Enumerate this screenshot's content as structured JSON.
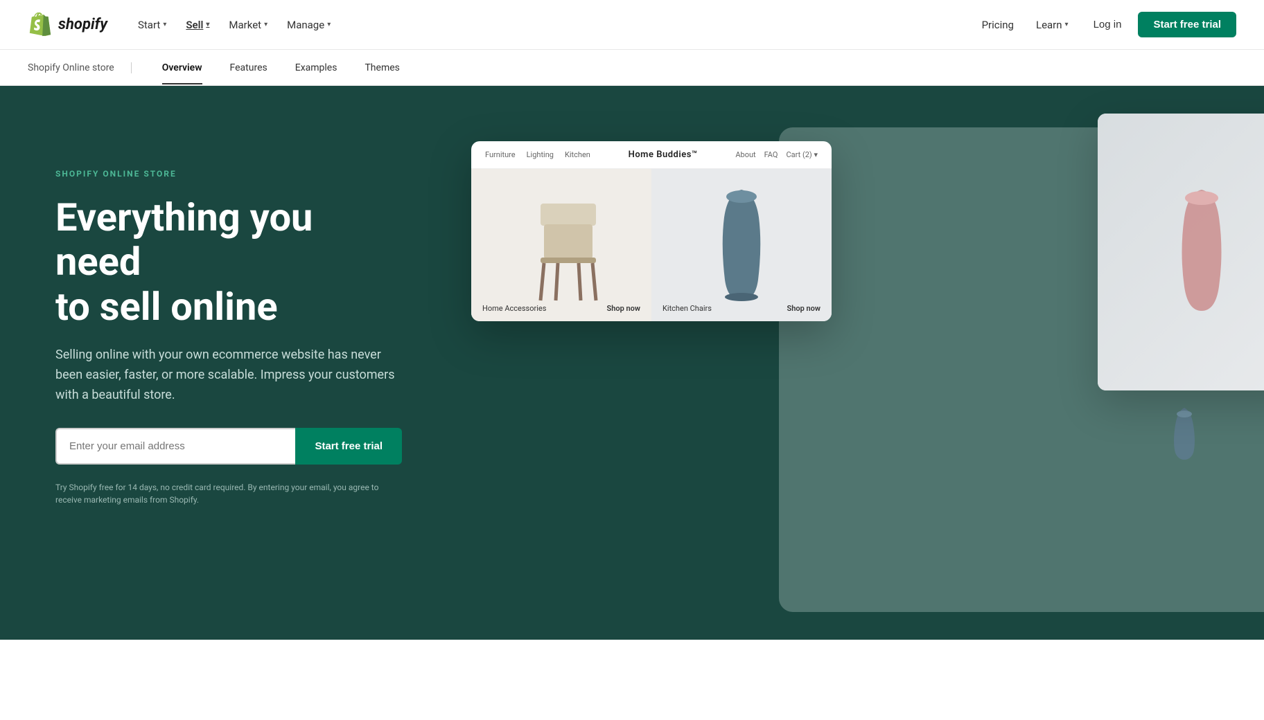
{
  "nav": {
    "logo_text": "shopify",
    "links_left": [
      {
        "label": "Start",
        "has_dropdown": true,
        "active": false
      },
      {
        "label": "Sell",
        "has_dropdown": true,
        "active": true
      },
      {
        "label": "Market",
        "has_dropdown": true,
        "active": false
      },
      {
        "label": "Manage",
        "has_dropdown": true,
        "active": false
      }
    ],
    "pricing_label": "Pricing",
    "learn_label": "Learn",
    "login_label": "Log in",
    "trial_label": "Start free trial"
  },
  "subnav": {
    "brand_label": "Shopify Online store",
    "items": [
      {
        "label": "Overview",
        "active": true
      },
      {
        "label": "Features",
        "active": false
      },
      {
        "label": "Examples",
        "active": false
      },
      {
        "label": "Themes",
        "active": false
      }
    ]
  },
  "hero": {
    "eyebrow": "SHOPIFY ONLINE STORE",
    "heading_line1": "Everything you need",
    "heading_line2": "to sell online",
    "subtext": "Selling online with your own ecommerce website has never been easier, faster, or more scalable. Impress your customers with a beautiful store.",
    "email_placeholder": "Enter your email address",
    "trial_btn_label": "Start free trial",
    "disclaimer": "Try Shopify free for 14 days, no credit card required. By entering your email, you agree to receive marketing emails from Shopify."
  },
  "store_preview": {
    "nav_links": [
      "Furniture",
      "Lighting",
      "Kitchen"
    ],
    "brand": "Home Buddies™",
    "right_links": [
      "About",
      "FAQ"
    ],
    "cart": "Cart (2) ▾",
    "products": [
      {
        "label": "Home Accessories",
        "shop_text": "Shop now"
      },
      {
        "label": "Kitchen Chairs",
        "shop_text": "Shop now"
      }
    ]
  },
  "colors": {
    "bg_dark": "#1a4740",
    "green_cta": "#008060",
    "eyebrow": "#4db896",
    "subtext": "#c8ddd9",
    "disclaimer": "#9ab8b2"
  }
}
